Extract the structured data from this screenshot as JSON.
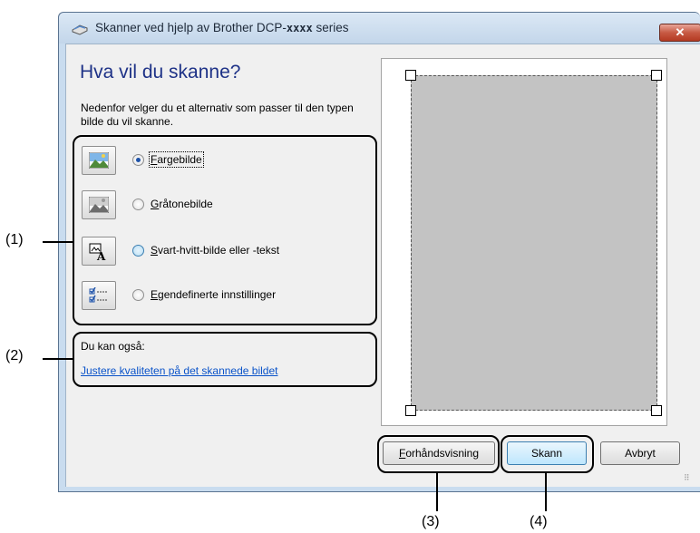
{
  "window": {
    "title_prefix": "Skanner ved hjelp av Brother DCP-",
    "title_model": "xxxx",
    "title_suffix": " series",
    "close_label": "✕"
  },
  "main": {
    "heading": "Hva vil du skanne?",
    "description": "Nedenfor velger du et alternativ som passer til den typen bilde du vil skanne."
  },
  "options": [
    {
      "key": "F",
      "rest": "argebilde",
      "selected": true
    },
    {
      "key": "G",
      "rest": "råtonebilde",
      "selected": false
    },
    {
      "key": "S",
      "rest": "vart-hvitt-bilde eller -tekst",
      "selected": false
    },
    {
      "key": "E",
      "rest": "gendefinerte innstillinger",
      "selected": false
    }
  ],
  "extras": {
    "heading": "Du kan også:",
    "link": "Justere kvaliteten på det skannede bildet"
  },
  "buttons": {
    "preview_key": "F",
    "preview_rest": "orhåndsvisning",
    "scan": "Skann",
    "cancel": "Avbryt"
  },
  "callouts": {
    "c1": "(1)",
    "c2": "(2)",
    "c3": "(3)",
    "c4": "(4)"
  },
  "colors": {
    "heading": "#1e3287",
    "link": "#0a53c9",
    "preview_area": "#c3c3c3"
  }
}
